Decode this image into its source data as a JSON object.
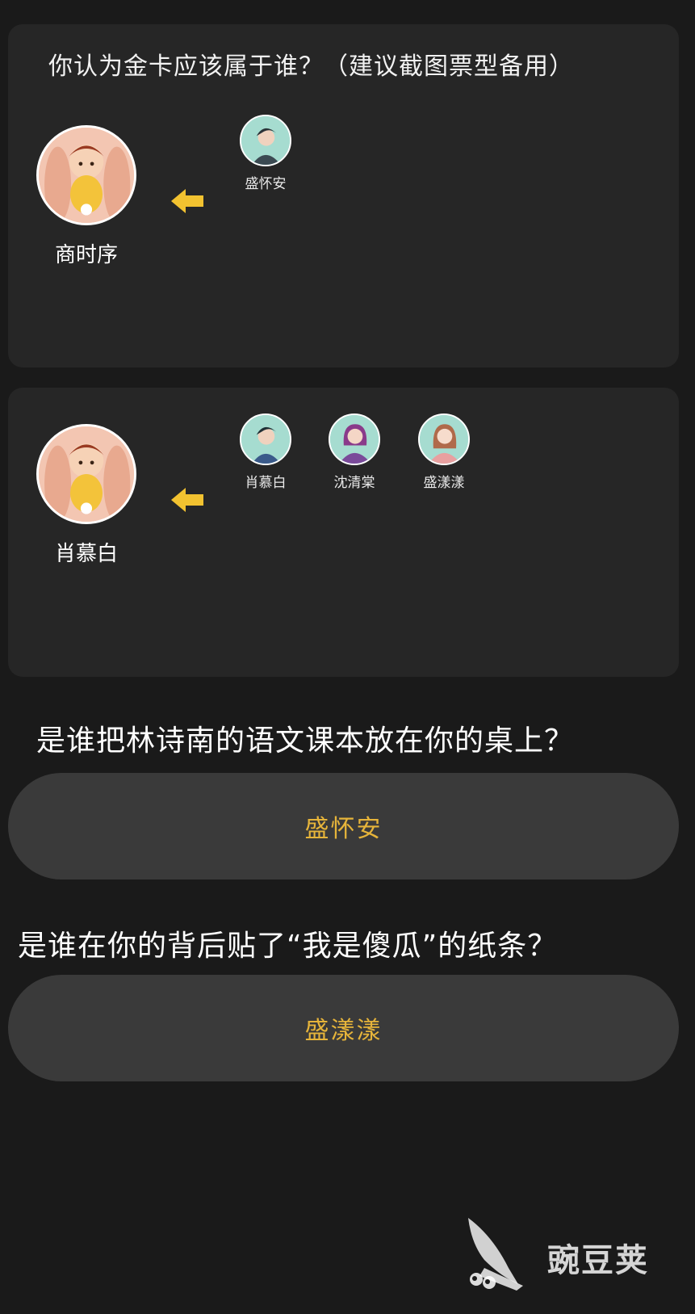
{
  "card1": {
    "title": "你认为金卡应该属于谁？（建议截图票型备用）",
    "selected": {
      "name": "商时序"
    },
    "candidates": [
      {
        "name": "盛怀安"
      }
    ]
  },
  "card2": {
    "selected": {
      "name": "肖慕白"
    },
    "candidates": [
      {
        "name": "肖慕白"
      },
      {
        "name": "沈清棠"
      },
      {
        "name": "盛漾漾"
      }
    ]
  },
  "questions": [
    {
      "text": "是谁把林诗南的语文课本放在你的桌上？",
      "answer": "盛怀安"
    },
    {
      "text": "是谁在你的背后贴了“我是傻瓜”的纸条？",
      "answer": "盛漾漾"
    }
  ],
  "watermark": {
    "text": "豌豆荚"
  },
  "colors": {
    "background": "#1a1a1a",
    "card": "#262626",
    "answer_pill": "#3a3a3a",
    "answer_text": "#e6b43a",
    "arrow": "#f2c230"
  },
  "icons": {
    "arrow": "arrow-left-icon",
    "watermark": "pea-pod-logo"
  }
}
